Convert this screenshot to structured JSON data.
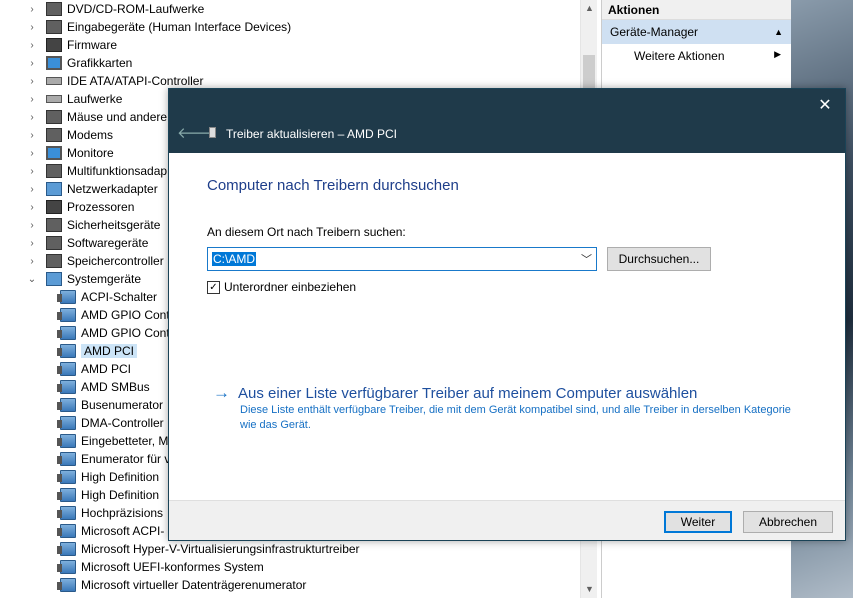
{
  "tree": {
    "items": [
      {
        "label": "DVD/CD-ROM-Laufwerke",
        "icon": "dvd-icon",
        "level": 0,
        "expanded": false
      },
      {
        "label": "Eingabegeräte (Human Interface Devices)",
        "icon": "hid-icon",
        "level": 0,
        "expanded": false
      },
      {
        "label": "Firmware",
        "icon": "firmware-icon",
        "level": 0,
        "expanded": false
      },
      {
        "label": "Grafikkarten",
        "icon": "display-adapter-icon",
        "level": 0,
        "expanded": false
      },
      {
        "label": "IDE ATA/ATAPI-Controller",
        "icon": "ide-icon",
        "level": 0,
        "expanded": false
      },
      {
        "label": "Laufwerke",
        "icon": "drive-icon",
        "level": 0,
        "expanded": false
      },
      {
        "label": "Mäuse und andere Z",
        "icon": "mouse-icon",
        "level": 0,
        "expanded": false
      },
      {
        "label": "Modems",
        "icon": "modem-icon",
        "level": 0,
        "expanded": false
      },
      {
        "label": "Monitore",
        "icon": "monitor-icon",
        "level": 0,
        "expanded": false
      },
      {
        "label": "Multifunktionsadap",
        "icon": "multifunction-icon",
        "level": 0,
        "expanded": false
      },
      {
        "label": "Netzwerkadapter",
        "icon": "network-adapter-icon",
        "level": 0,
        "expanded": false
      },
      {
        "label": "Prozessoren",
        "icon": "processor-icon",
        "level": 0,
        "expanded": false
      },
      {
        "label": "Sicherheitsgeräte",
        "icon": "security-device-icon",
        "level": 0,
        "expanded": false
      },
      {
        "label": "Softwaregeräte",
        "icon": "software-device-icon",
        "level": 0,
        "expanded": false
      },
      {
        "label": "Speichercontroller",
        "icon": "storage-controller-icon",
        "level": 0,
        "expanded": false
      },
      {
        "label": "Systemgeräte",
        "icon": "system-devices-icon",
        "level": 0,
        "expanded": true
      },
      {
        "label": "ACPI-Schalter",
        "icon": "device-icon",
        "level": 1
      },
      {
        "label": "AMD GPIO Cont",
        "icon": "device-icon",
        "level": 1
      },
      {
        "label": "AMD GPIO Cont",
        "icon": "device-icon",
        "level": 1
      },
      {
        "label": "AMD PCI",
        "icon": "device-icon",
        "level": 1,
        "selected": true
      },
      {
        "label": "AMD PCI",
        "icon": "device-icon",
        "level": 1
      },
      {
        "label": "AMD SMBus",
        "icon": "device-icon",
        "level": 1
      },
      {
        "label": "Busenumerator",
        "icon": "device-icon",
        "level": 1
      },
      {
        "label": "DMA-Controller",
        "icon": "device-icon",
        "level": 1
      },
      {
        "label": "Eingebetteter, M",
        "icon": "device-icon",
        "level": 1
      },
      {
        "label": "Enumerator für v",
        "icon": "device-icon",
        "level": 1
      },
      {
        "label": "High Definition",
        "icon": "device-icon",
        "level": 1
      },
      {
        "label": "High Definition",
        "icon": "device-icon",
        "level": 1
      },
      {
        "label": "Hochpräzisions",
        "icon": "device-icon",
        "level": 1
      },
      {
        "label": "Microsoft ACPI-",
        "icon": "device-icon",
        "level": 1
      },
      {
        "label": "Microsoft Hyper-V-Virtualisierungsinfrastrukturtreiber",
        "icon": "device-icon",
        "level": 1
      },
      {
        "label": "Microsoft UEFI-konformes System",
        "icon": "device-icon",
        "level": 1
      },
      {
        "label": "Microsoft virtueller Datenträgerenumerator",
        "icon": "device-icon",
        "level": 1
      }
    ]
  },
  "actions": {
    "header": "Aktionen",
    "group": "Geräte-Manager",
    "item": "Weitere Aktionen"
  },
  "dialog": {
    "caption": "Treiber aktualisieren – AMD PCI",
    "heading": "Computer nach Treibern durchsuchen",
    "location_label": "An diesem Ort nach Treibern suchen:",
    "path_value": "C:\\AMD",
    "browse_label": "Durchsuchen...",
    "include_subfolders_label": "Unterordner einbeziehen",
    "include_subfolders_checked": true,
    "list_link": "Aus einer Liste verfügbarer Treiber auf meinem Computer auswählen",
    "list_link_desc": "Diese Liste enthält verfügbare Treiber, die mit dem Gerät kompatibel sind, und alle Treiber in derselben Kategorie wie das Gerät.",
    "next_label": "Weiter",
    "cancel_label": "Abbrechen"
  }
}
